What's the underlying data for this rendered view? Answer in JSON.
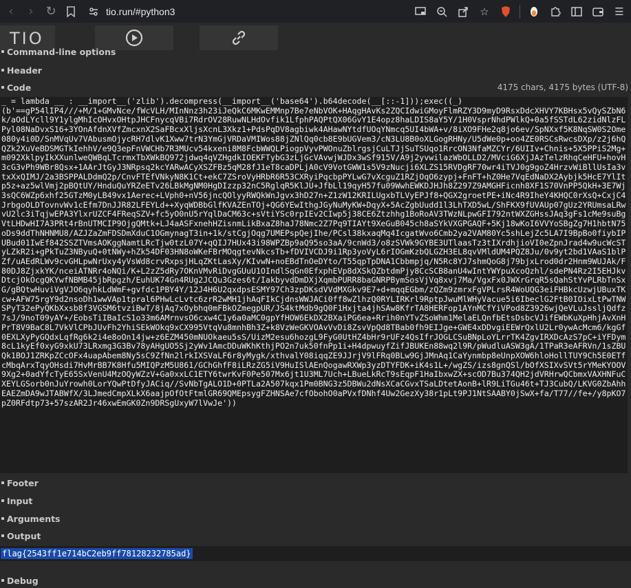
{
  "browser": {
    "url": "tio.run/#python3"
  },
  "sections": {
    "cmdline": "Command-line options",
    "header": "Header",
    "code": "Code",
    "footer": "Footer",
    "input": "Input",
    "arguments": "Arguments",
    "output": "Output",
    "debug": "Debug"
  },
  "code_counter": "4175 chars, 4175 bytes (UTF-8)",
  "code_text": "_ = lambda __ : __import__('zlib').decompress(__import__('base64').b64decode(__[::-1]));exec((_)\n(b'==gP54lIP4///+M/1+GMvNce/fWcVLH/MInNnz3h23iJeQkC6MKwEMMnp7Be7eNbVOK+HAqgHAvKs2ZQCIdwiGMoyFlmRZY3D9myD9RsxDdcXHVY7KBHsx5vQySZbN6k/aOdLYcll9Y1ylgMhIcOHvxOHtpJHCFnycqVBi7RdrOV28RuwNLHdOvfik1LfphPAQPtQX06GvY1E4opz8haLDIS8aY5Y/1H0VsprNhdPWlkQ+0a5fSSTdL62zidNlzFLPyl08NaDvxS16+3YOnAfdnXVfZmcxnX2SaFBcxXljsXcnL3Xkz1+PdsPqDV8agbiwk4AHawNYtdfUOqYNmcq5UI4bWA+v/8iXO9FHe2q8jo6ev/SpNXxf5K8NqSW0S2Ome080y4i0D/SnMVqUv7VAbusmOjycRH7dlvK1Xww7trN3YmGjVRDaVMIWos88jZNlQq0cb8E9bUGVem3/cN3LU8B0oXLGogRHNy/U5dWe0p+oo4ZE0RSCsRwcsDXp/z2j6hQQZk2XuVeBDSMGTkIehhV/e9Q3epFnVWCHb7R3MUcv54kxeni8M8FcbWWQLPiogpVyvPWOnuZblrgsjCuLTJjSuTSUqo1RrcON3NfaMZCYr/6UIIv+Chnis+5X5PPiS2Mg+m092XklpyIkXXunlweQWBqLTcrmxTbXWkBQ972jdwq4qVZHgdkIOEKFTybG3zLjGcVAvwjWJDx3wSf915V/A9j2yvwilazWbOLLD2/MVciG6XjJAzTelzRhqCeHFU+hovH3cG3vPh9WBr8Qsx+1AArJtGyJ3NRpsq2kcYARwACyXSZFBz5qM28fJ1eT8caDPLjA0cV9VotGWW1s5V9zNucji6XLZS15RVDgRF70wr4iTVJ0g9goZ4HrzvWiBllUsIa3vtxXxQIMJ/2a3BSPPALDdmQ2p/CnvFTEfVNkyN8K1Ct+ekC7ZSroVyHRbR6R53CXRyiPqcbpPYLwG7vXcguZ1RZjOqO6zypj+FnFT+hZ0He7VqEdNaDX2Aybjk5HcE7YlItp5z+az5wlVmj2pBQtUY/HnduQuYRZeETv26LBkMgNM0HgDIzzp32nC5RglqR5KlJU+JfbLl19qyH57fu09WwhEWKDJHJh8Z297Z9AMGHFicnh8XF1S70VnPP5QkH+3E7Wj3sQC6WZp6xhf25GTzM0yLB49vx1Aerec+LVph0+nV56jncQOlyyRWQkWnJgvx3hD27n+Z1zW12KRILUgxbTLVyEPJf8+QGX2groetPE+iNc4R9IheY4KHQC0rXsQ+CxjC4JrbgoOLDTovnvWv1cEfm7DnJJR82LFEYLd++XyqWDBbGlfKVAZEnTOj+QG6YEwIthgJGyNuMyKW+DqyX+5AcZgbUudd1l3LhTXD5wL/ShFKX9fUVAUp07gUz2YRUmsaLRwvU2lc3iTqjwEPA3YlxrUZCF4FReqSZV+fc5yO0nU5rYqlDaCM63c+sVtiYSc0rpIEv2CIwp5j38CE6Ztzhhg1BoRoAV3TWzNLpwGFI792ntWXZGHssJAq3gFs1cMe9suBgVtLHDwHI7A3PRt4rBnUTMCIP9OjgQMtk+LJ4aASFxnehHZisnmLikBxaZ8haJ78Nmc2Z7Pq9TIAYt9XeGuB045ch8aSYkVXGPGAQF+5Kj18wKoI6VVYoSBgZg7H1hbtN75oDs9ddThNHNMU8/AZJZaZmFDSDmXduC1OGmynagT3in+1k/stCgjOqg7UMEPspQejIhe/PCsl38kxaqMq4IcgatWvo6Cmb2ya2VAM80Yc5shLejZc5LA7I9BpBo0fiybIPUBud01IwEf842SSZTVmsAOKggNamtLRcTjw0tzL07Y+qQIJ7HUx43i98WPZBp9aQ95so3aA/9cnWd3/o8zSVWk9GYBE3UTlaasTz3tIXrdhjioVI0eZpnJrad4w9ucWcSTyLZkR2i+gPkTuZ3NByuQ+0tNWy+hZk54DF03HN8oWKeFBrMOqgtevNkcsTb+fDVIVCDJ9i1Rp3yoVyL6rIOGmKzbQLGZH3EL8qvVMldUM4PQZ8Ju/0v9yt2bd1VAaS1blPZf/uAEdRLWv9cvGHLpwNrUxy4yVsWd8crvRxpsjHLqZKtLasXy/KIvwN+noEBdTnOeDYto/T55qpTpDNA1Cbbmpjq/N5Rc8YJ7shmQoG8j79bjxLrod0dr2Hnm9WUJAk/F80DJ8ZjxkYK/nceiATNRr4oNQi/K+L2zZ5dRy7OKnVMvRiDvgGUuU1OIndlSqGn0EfxphEVp8dXSkQZbtdmPjy8CcSCB8anU4wIntYWYpuXcoQzhl/sdePN4Rz2I5EHJkvDtcjOkOcgQKYwfNBMB45jbRpgzh/EuhUK74Gn4RUg2JCQu3Gzes6t/IakbyvdDmDXjXqmbPURR8baGNRPBymSosVjVq8xvj7Ma/VgxFx0JWXrGrqR5sQahStYvPLRbTnSxG/gBQtwHuviVgVJO6qyhkLdWmF+gvfdc1PBY4Y/12J4H6U2qxdpsESMY97Ch3zpDKsdVVdMXGkv9E7+d+mqqEGbm/zQZm9zmrxFgVPLrsR4WoUQG3eiFHBkcUzwjUBuxTKcw+AFW75rgY9d2nsoDh1wwVAp1tpral6PHwLcLvtc6zrR2wMH1jhAqFIkCjdnsWWJACi0ff8wZlhzQ0RYLIRKrl9RptpJwuMlWHyVacue5i6IbeclG2FtB0IOixLtPwTNWSPyT32ePyQKbXxsb8f3VGSM6tvziBwT/8jAq7xOybhq0mFBkOZmegpUR/JS4ktMdb9gQ0F1Hxjta4jhSAw8KfrTA8HERFop1AYnMCfYiVPod8Z3926wjQeVLuJssljQdfz7sJ/9noT09yAY+/EobsTiIBaIcS1o33m6AMrnvsO6cxw4C1y6a0aMC0gpYfHOW6EkDX2BXaiPG6ea+Rrih0nYTvZSoWhm1MelaELQnfbEtsDsbcVJifEWbKuXpHhjAvXnHPrT8V9BaC8L7VkVlCPbJUvFh2YhiSEkWOkq9xCX995VtqVu8mnhBh3Z+k8VzWeGKVOAvVvDi8ZsvVpQd8TBab0fh9EIJge+GWE4xDDvgiEEWrQxlU2Lr0ywAcMcm6/kgGf0EXLXyPyGQdxLqfRg6k2i4e8oOn14jw+z6EZM450mNUOkaeu5sS/UizM2esu6hozgL9FyG0UtHZ4bHr9rUFz4QsIfrJOGLCSuBNpLoYLrrTK4ZgvIRXDcAzS7pC+iYFDym8cL1kyEf0xyG9xkU73LRxmg3G3Bv78yAHgUO5Sj2yWv1AmcDDuWKhKthjPO2n7uk50fnPp1i+H4dpwuyfZifJBUKEn88wq2l9R/pWudluASW3gA/1TPaR3eAFRVn/1sZBUQk1BOJ1ZRKpZCcOFx4uapAbem8Ny5sC9ZfNn2lrkIXSVaLF6r8yMygk/xthvalY08iqqZE9JJrjV9lFRq0BLw9GjJMnAq1CaYynmbp8eUnpXOW6hloHollTUY9Ch5E0ETfcMbqArxTqyOHsdi7HvMrBB7K8Hfu5MIQPzM5U861/GChGhfF8iLRzZG5iV9HuISlAEnQogawRXWp3yzDTYFDK+iK4s1L+/wgZS/izs8gnQSl/bOfXSIXvSVt5rYMeKYOOV9Xg2+0adYfcTyE65SxVenU4MzOQyWZzV+Ga0xxLC1ETY6twrKvF0Pe507Mx6jt1U3ML7Uch+LBueLkRcT9sEqpF1HaIbxwZX+scOD7Bu374QH2jdVRHrwQCbmxVAXHNFuCXEYLGSorb0nJuYrowh0LorYQwPtDfyJACiq//SvNbTgALO1D+0PTLa2A507kqx1Pm0BNG3z5DBWu2dNsXCaCGvxTSaLDtetAonB+lR9LiTGu46t+TJ3CubQ/LKVG0ZbAhhEAEZmDA9wJTABWfX/3LJmedCmpXLkX6aajpOfOtFtmlGR69QMEpsygFZHNSAe7cfObohO0aPVxfDNhf4Uw2GezXy38r1pLt9PJ1NtSAABY0jSwX+fa/T77//fe+/y8pKO7pZ0RFdtp73+57szAR2Jr46xwEmGK0Zn9DRSgUxyW7lVwJe'))",
  "output_text": "flag{2543ff1e714bC2eb9ff78128232785ad}",
  "colors": {
    "selection": "#1a4aa8",
    "code_bg": "#1e1e1e",
    "page_bg": "#2a2a2a"
  }
}
